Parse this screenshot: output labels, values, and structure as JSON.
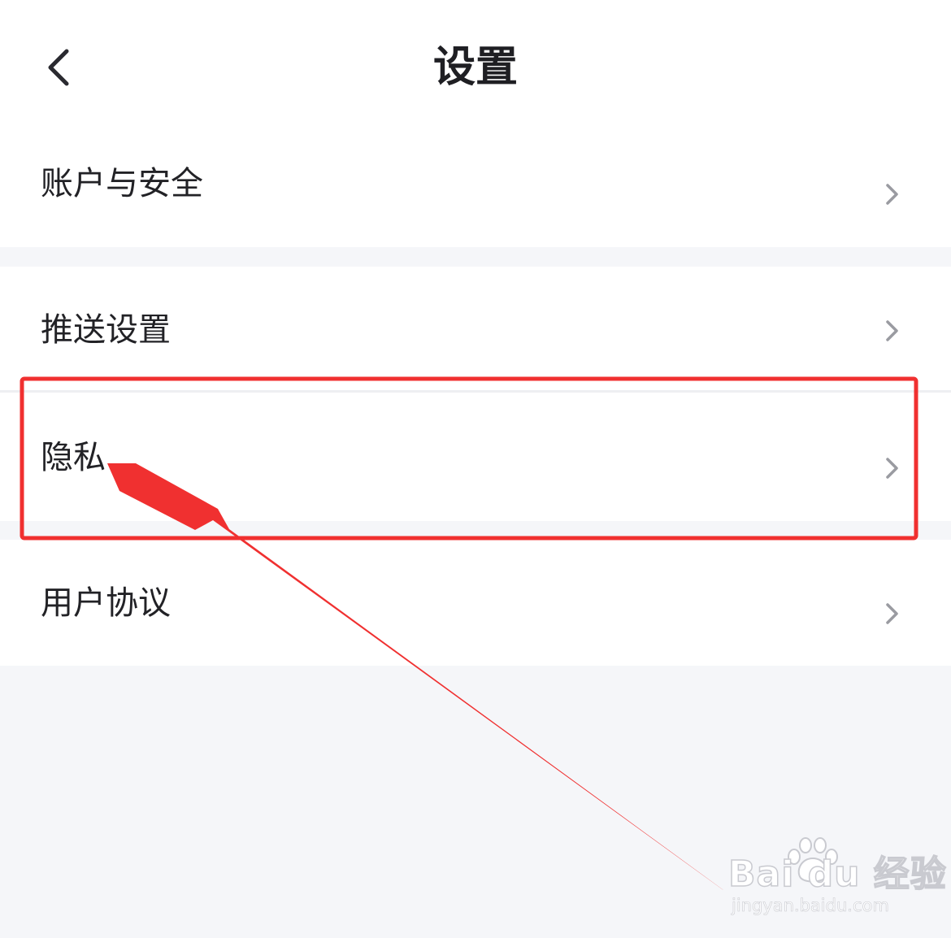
{
  "header": {
    "title": "设置",
    "back_icon": "chevron-left-icon"
  },
  "settings": {
    "items": [
      {
        "label": "账户与安全",
        "icon": "chevron-right-icon"
      },
      {
        "label": "推送设置",
        "icon": "chevron-right-icon"
      },
      {
        "label": "隐私",
        "icon": "chevron-right-icon"
      },
      {
        "label": "用户协议",
        "icon": "chevron-right-icon"
      }
    ]
  },
  "annotation": {
    "highlight_color": "#f03030",
    "target": "隐私"
  },
  "watermark": {
    "logo": "Bai du 经验",
    "url": "jingyan.baidu.com"
  },
  "colors": {
    "background": "#f5f6f9",
    "card": "#ffffff",
    "title_text": "#1f1f23",
    "chevron": "#9a9ba1"
  }
}
